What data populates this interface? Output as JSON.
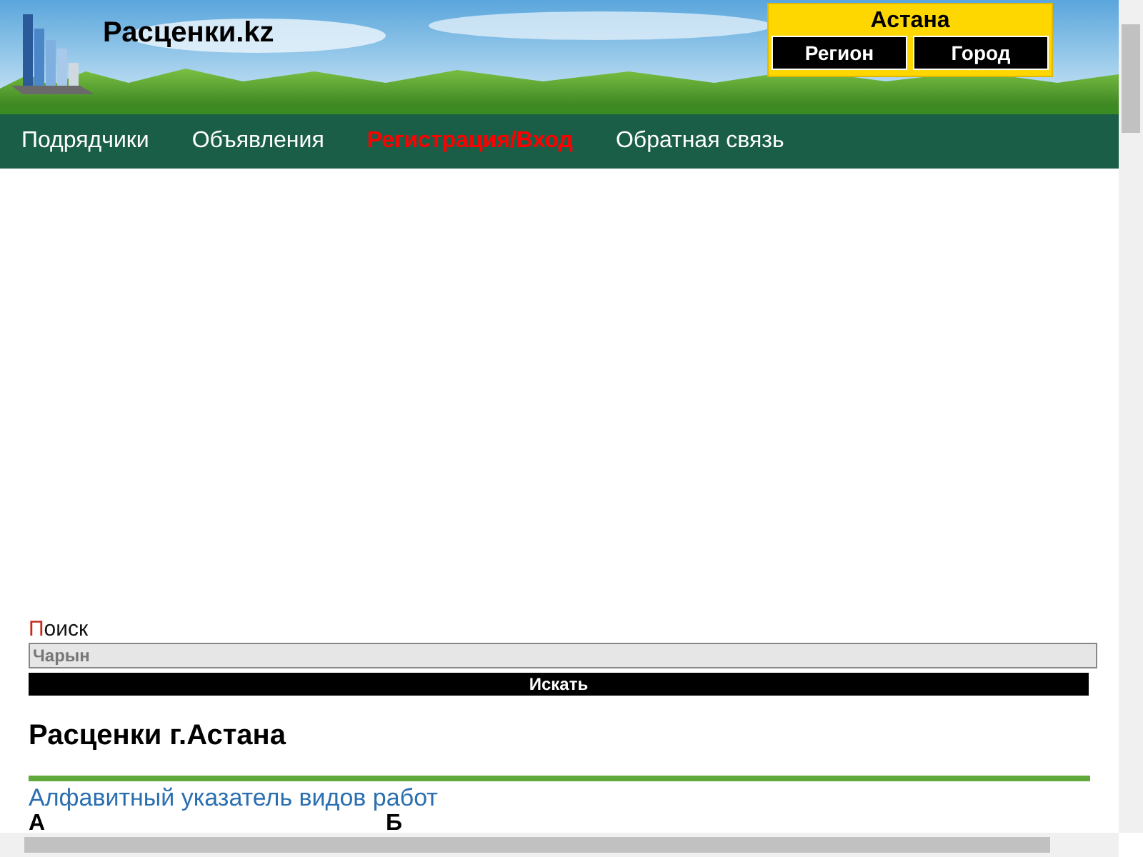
{
  "site": {
    "title": "Расценки.kz"
  },
  "city_box": {
    "city": "Астана",
    "buttons": [
      "Регион",
      "Город"
    ]
  },
  "nav": [
    {
      "label": "Подрядчики",
      "highlighted": false
    },
    {
      "label": "Объявления",
      "highlighted": false
    },
    {
      "label": "Регистрация/Вход",
      "highlighted": true
    },
    {
      "label": "Обратная связь",
      "highlighted": false
    }
  ],
  "search": {
    "label_accent": "П",
    "label_rest": "оиск",
    "value": "Чарын",
    "button": "Искать"
  },
  "heading": "Расценки г.Астана",
  "index_link": "Алфавитный указатель видов работ",
  "letters": [
    "А",
    "Б"
  ]
}
